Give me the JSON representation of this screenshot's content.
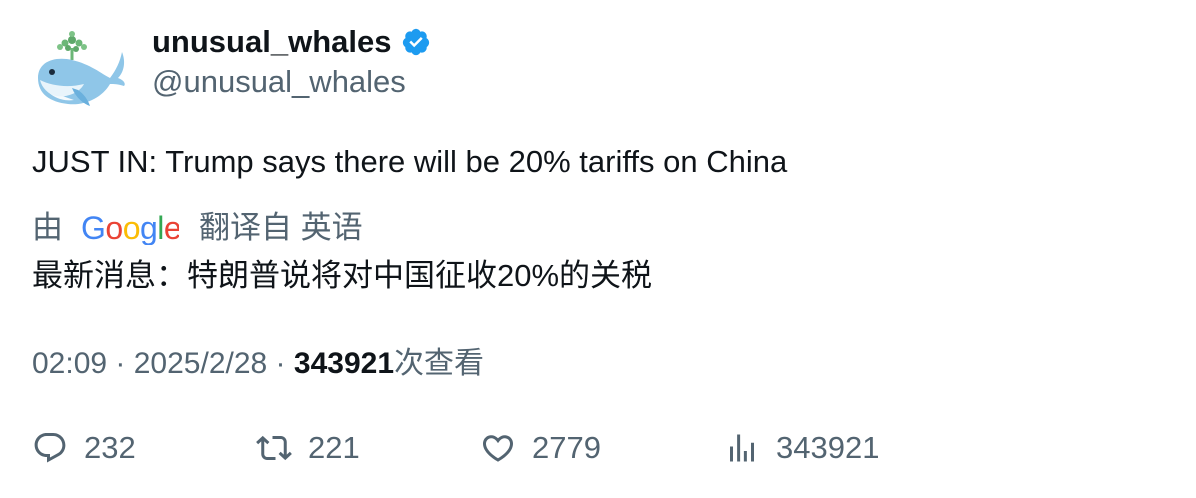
{
  "author": {
    "display_name": "unusual_whales",
    "handle": "@unusual_whales",
    "verified_color": "#1d9bf0",
    "avatar_icon": "whale-icon"
  },
  "tweet": {
    "text": "JUST IN: Trump says there will be 20% tariffs on China"
  },
  "translation": {
    "by_label": "由",
    "provider_logo": "Google",
    "from_label": "翻译自 英语",
    "text": "最新消息：特朗普说将对中国征收20%的关税"
  },
  "meta": {
    "time": "02:09",
    "sep1": " · ",
    "date": "2025/2/28",
    "sep2": " · ",
    "views_count": "343921",
    "views_label": "次查看"
  },
  "actions": {
    "replies": "232",
    "retweets": "221",
    "likes": "2779",
    "views": "343921"
  },
  "colors": {
    "text": "#0f1419",
    "secondary": "#536471",
    "verified": "#1d9bf0"
  }
}
